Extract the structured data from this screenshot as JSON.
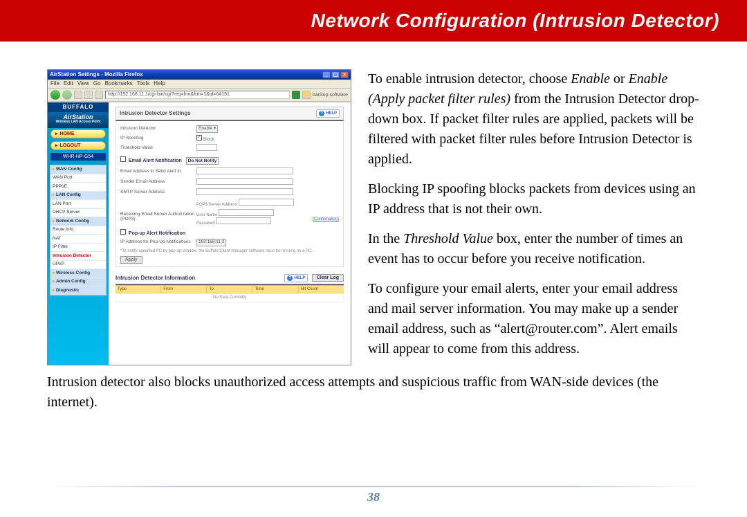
{
  "banner": {
    "title": "Network Configuration (Intrusion Detector)"
  },
  "browser": {
    "title": "AirStation Settings - Mozilla Firefox",
    "menu": [
      "File",
      "Edit",
      "View",
      "Go",
      "Bookmarks",
      "Tools",
      "Help"
    ],
    "url": "http://192.168.11.1/cgi-bin/cgi?req=frm&frm=1&id=64191",
    "backup_label": "backup software"
  },
  "sidebar": {
    "logo": "BUFFALO",
    "product": "AirStation",
    "product_sub": "Wireless LAN Access Point",
    "home": "HOME",
    "logout": "LOGOUT",
    "model": "WHR-HP-G54",
    "items": [
      {
        "label": "WAN Config",
        "top": true
      },
      {
        "label": "WAN Port"
      },
      {
        "label": "PPPoE"
      },
      {
        "label": "LAN Config",
        "top": true
      },
      {
        "label": "LAN Port"
      },
      {
        "label": "DHCP Server"
      },
      {
        "label": "Network Config",
        "top": true
      },
      {
        "label": "Route Info"
      },
      {
        "label": "NAT"
      },
      {
        "label": "IP Filter"
      },
      {
        "label": "Intrusion Detector",
        "active": true
      },
      {
        "label": "UPnP"
      },
      {
        "label": "Wireless Config",
        "top": true
      },
      {
        "label": "Admin Config",
        "top": true
      },
      {
        "label": "Diagnostic",
        "top": true
      }
    ]
  },
  "panel": {
    "title": "Intrusion Detector Settings",
    "help": "HELP",
    "rows": {
      "intrusion_detector": "Intrusion Detector",
      "intrusion_detector_val": "Enable",
      "ip_spoofing": "IP Spoofing",
      "ip_spoofing_val": "Block",
      "threshold": "Threshold Value"
    },
    "email_section": "Email Alert Notification",
    "email_toggle": "Do Not Notify",
    "email_rows": {
      "to": "Email Address to Send Alert to",
      "from": "Sender Email Address",
      "smtp": "SMTP Server Address",
      "pop3_label": "POP3 Server Address",
      "auth": "Receiving Email Server Authorization (POP3)",
      "user": "User Name",
      "pass": "Password",
      "confirm": "(Confirmation)"
    },
    "popup_section": "Pop-up Alert Notification",
    "popup_row": "IP Address for Pop-Up Notifications",
    "popup_val": "192.168.11.2",
    "popup_note": "*To notify specified PC by pop-up window, the Buffalo Client Manager software must be running on a PC.",
    "apply": "Apply",
    "info_title": "Intrusion Detector Information",
    "clear_log": "Clear Log",
    "table_cols": [
      "Type",
      "From",
      "To",
      "Time",
      "Hit Count"
    ],
    "table_empty": "No Data Currently"
  },
  "body": {
    "p1_a": "To enable intrusion detector, choose ",
    "p1_em1": "Enable",
    "p1_b": " or ",
    "p1_em2": "Enable (Apply packet filter rules)",
    "p1_c": " from the Intrusion Detector drop-down box.  If packet filter rules are applied, packets will be filtered with packet filter rules before Intrusion Detector is applied.",
    "p2": "Blocking IP spoofing blocks packets from devices using an IP address that is not their own.",
    "p3_a": "In the ",
    "p3_em": "Threshold Value",
    "p3_b": " box, enter the number of times an event has to occur before you receive notification.",
    "p4": "To configure your email alerts, enter your email address and mail server information.  You may make up a sender email address, such as “alert@router.com”.  Alert emails will appear to come from this address.",
    "p5": "Intrusion detector also blocks unauthorized access attempts and suspicious traffic from WAN-side devices (the internet)."
  },
  "page_number": "38"
}
